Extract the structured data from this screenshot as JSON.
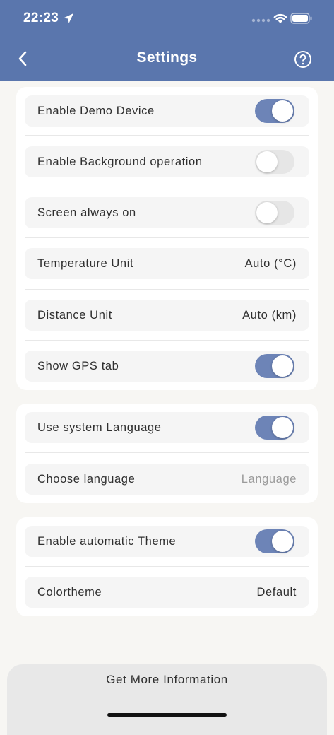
{
  "status_bar": {
    "time": "22:23"
  },
  "nav": {
    "title": "Settings"
  },
  "groups": [
    {
      "rows": [
        {
          "label": "Enable Demo Device",
          "control": "toggle",
          "on": true
        },
        {
          "label": "Enable Background operation",
          "control": "toggle",
          "on": false
        },
        {
          "label": "Screen always on",
          "control": "toggle",
          "on": false
        },
        {
          "label": "Temperature Unit",
          "control": "value",
          "value": "Auto (°C)"
        },
        {
          "label": "Distance Unit",
          "control": "value",
          "value": "Auto (km)"
        },
        {
          "label": "Show GPS tab",
          "control": "toggle",
          "on": true
        }
      ]
    },
    {
      "rows": [
        {
          "label": "Use system Language",
          "control": "toggle",
          "on": true
        },
        {
          "label": "Choose language",
          "control": "value",
          "placeholder": "Language"
        }
      ]
    },
    {
      "rows": [
        {
          "label": "Enable automatic Theme",
          "control": "toggle",
          "on": true
        },
        {
          "label": "Colortheme",
          "control": "value",
          "value": "Default"
        }
      ]
    }
  ],
  "footer": {
    "button_label": "Get More Information"
  },
  "colors": {
    "nav_background": "#5a76ad",
    "toggle_on": "#6d84b7",
    "toggle_off": "#e6e6e6",
    "page_background": "#f7f6f3"
  },
  "icons": [
    "location-arrow-icon",
    "cellular-signal-icon",
    "wifi-icon",
    "battery-icon",
    "back-chevron-icon",
    "help-circle-icon"
  ]
}
